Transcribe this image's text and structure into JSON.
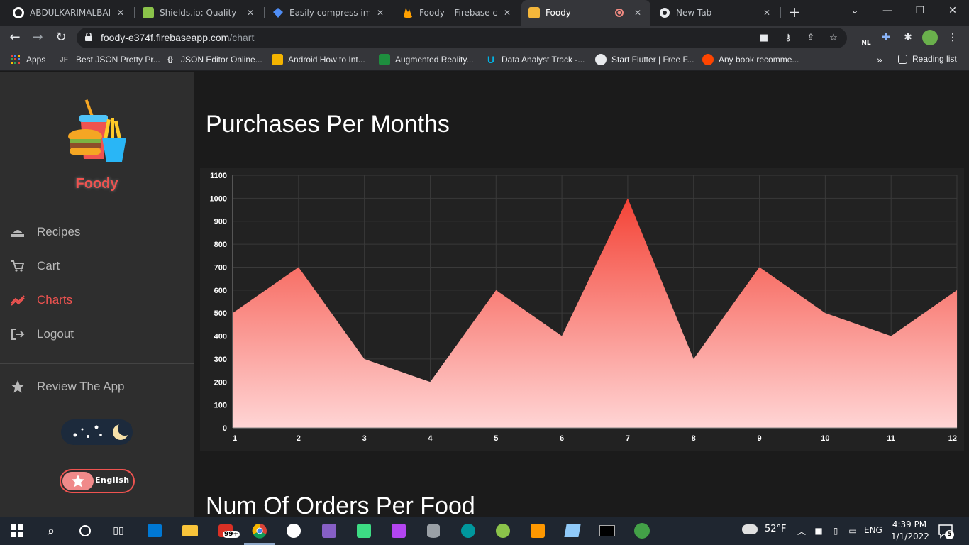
{
  "browser": {
    "tabs": [
      {
        "title": "ABDULKARIMALBAIK/",
        "icon": "github-icon"
      },
      {
        "title": "Shields.io: Quality met",
        "icon": "shields-icon"
      },
      {
        "title": "Easily compress image",
        "icon": "compress-icon"
      },
      {
        "title": "Foody – Firebase cons",
        "icon": "firebase-icon"
      },
      {
        "title": "Foody",
        "icon": "foody-icon",
        "active": true
      },
      {
        "title": "New Tab",
        "icon": "chrome-icon"
      }
    ],
    "url_host": "foody-e374f.firebaseapp.com",
    "url_path": "/chart",
    "bookmarks": [
      {
        "label": "Apps",
        "icon": "apps-grid-icon"
      },
      {
        "label": "Best JSON Pretty Pr...",
        "icon": "jf-icon"
      },
      {
        "label": "JSON Editor Online...",
        "icon": "json-braces-icon"
      },
      {
        "label": "Android How to Int...",
        "icon": "android-icon"
      },
      {
        "label": "Augmented Reality...",
        "icon": "ar-icon"
      },
      {
        "label": "Data Analyst Track -...",
        "icon": "udacity-icon"
      },
      {
        "label": "Start Flutter | Free F...",
        "icon": "globe-icon"
      },
      {
        "label": "Any book recomme...",
        "icon": "reddit-icon"
      }
    ],
    "bookmarks_more": "»",
    "reading_list": "Reading list",
    "extension_badge": "NL"
  },
  "sidebar": {
    "brand": "Foody",
    "nav": [
      {
        "label": "Recipes",
        "icon": "recipes-icon"
      },
      {
        "label": "Cart",
        "icon": "cart-icon"
      },
      {
        "label": "Charts",
        "icon": "chart-trend-icon",
        "active": true
      },
      {
        "label": "Logout",
        "icon": "logout-icon"
      }
    ],
    "review": {
      "label": "Review The App",
      "icon": "star-icon"
    },
    "language_toggle": "English"
  },
  "main": {
    "chart_title": "Purchases Per Months",
    "chart2_title": "Num Of Orders Per Food"
  },
  "chart_data": {
    "type": "area",
    "title": "Purchases Per Months",
    "x": [
      1,
      2,
      3,
      4,
      5,
      6,
      7,
      8,
      9,
      10,
      11,
      12
    ],
    "values": [
      500,
      700,
      300,
      200,
      600,
      400,
      1000,
      300,
      700,
      500,
      400,
      600
    ],
    "ylim": [
      0,
      1100
    ],
    "yticks": [
      0,
      100,
      200,
      300,
      400,
      500,
      600,
      700,
      800,
      900,
      1000,
      1100
    ],
    "xlabel": "",
    "ylabel": "",
    "grid": true,
    "colors": {
      "top": "#f44336",
      "bottom": "#ffd5d5"
    }
  },
  "taskbar": {
    "weather": "52°F",
    "language": "ENG",
    "time": "4:39 PM",
    "date": "1/1/2022",
    "notifications": "5",
    "mail_badge": "99+"
  }
}
